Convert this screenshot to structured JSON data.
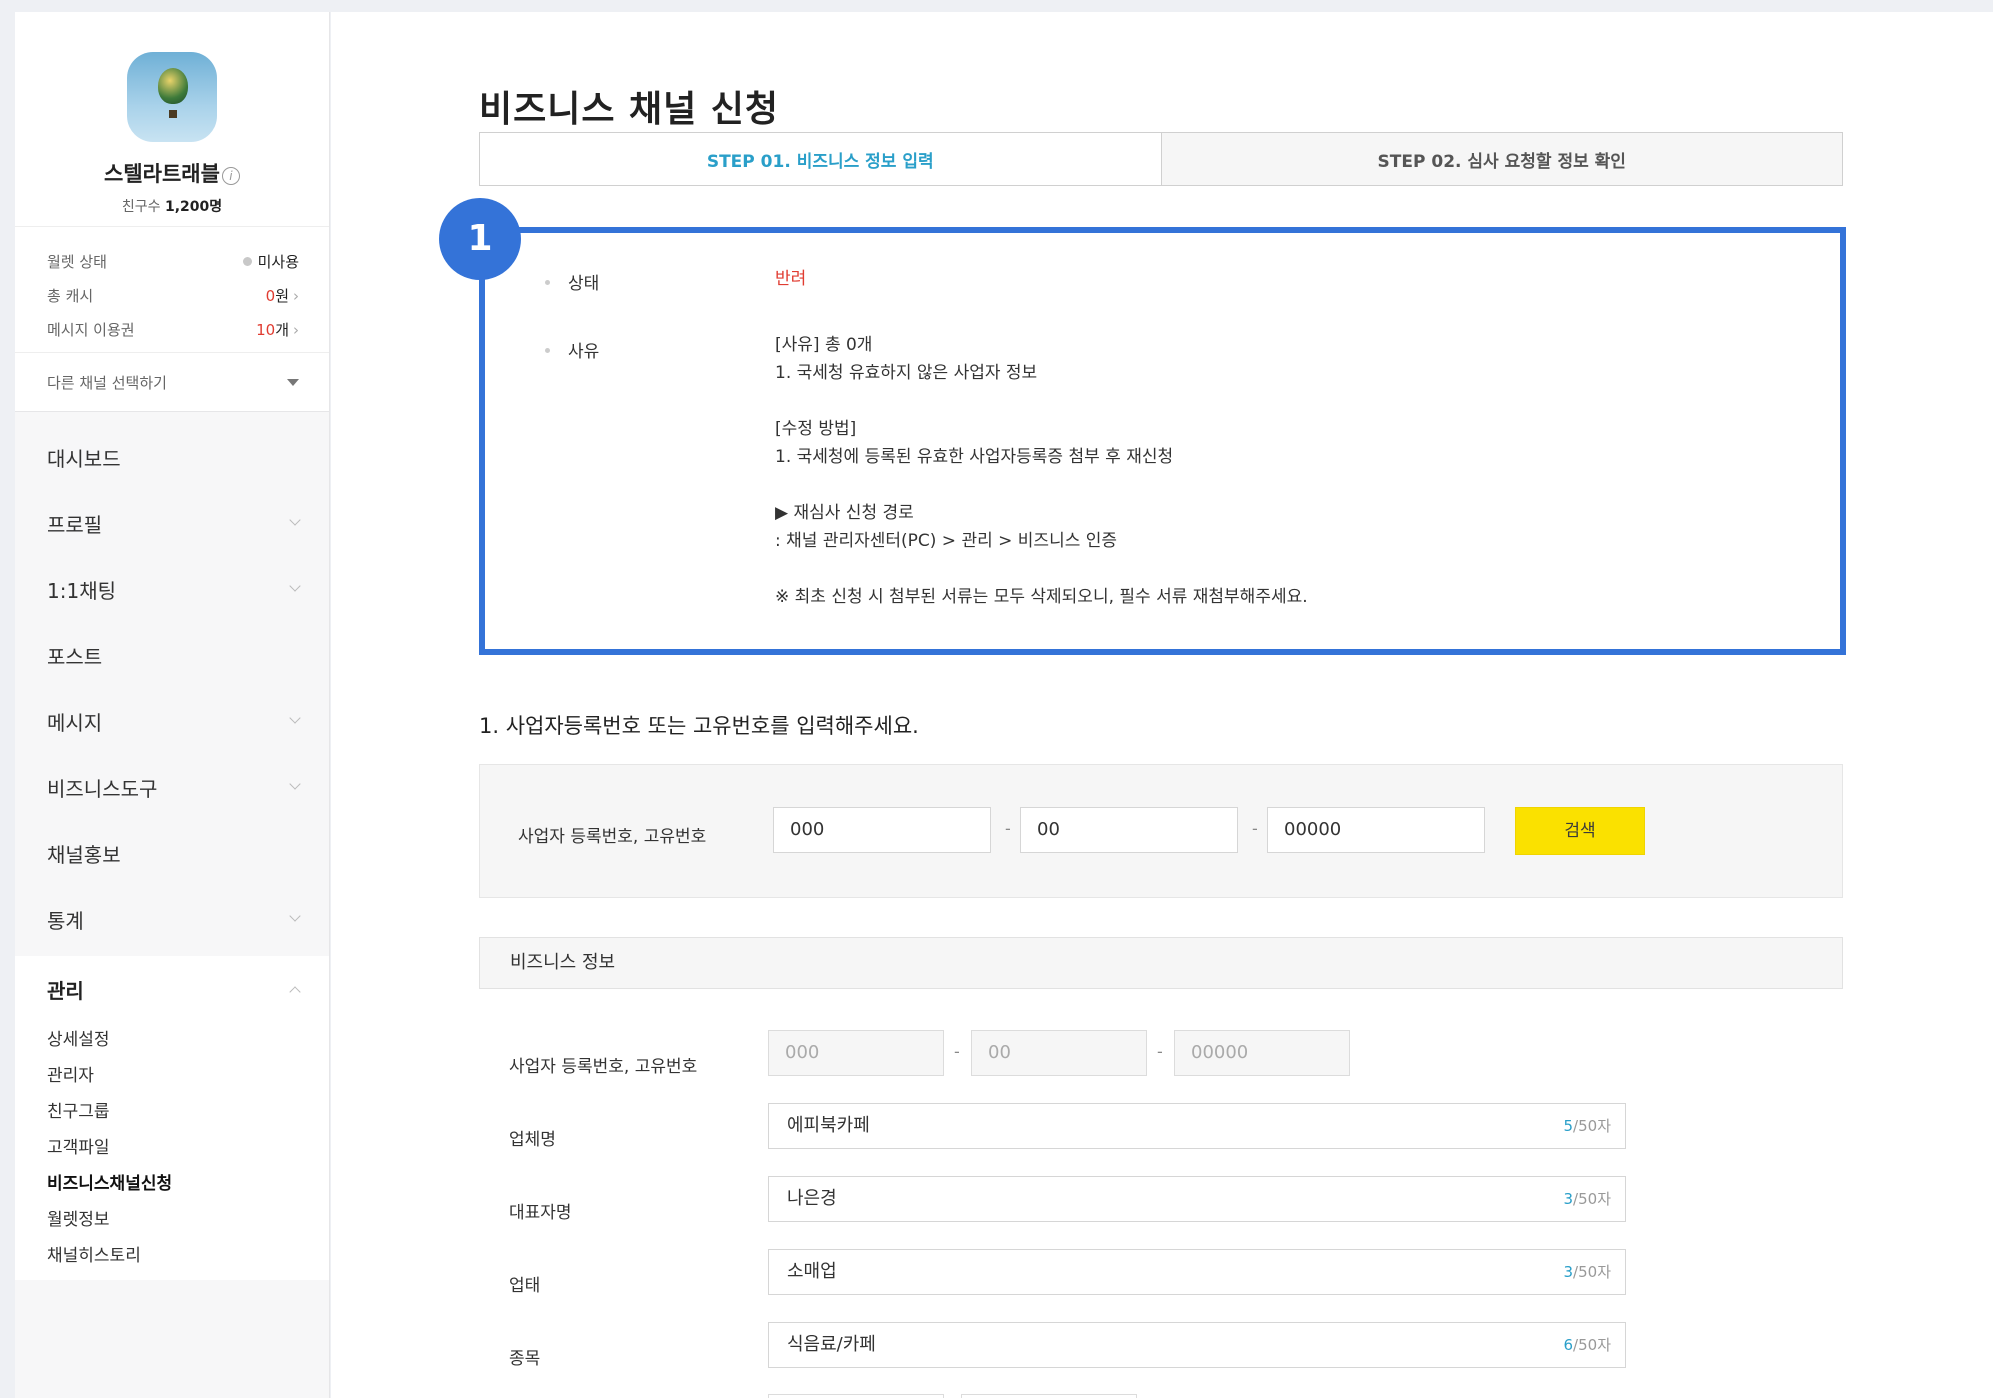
{
  "sidebar": {
    "profile_name": "스텔라트래블",
    "friends_label": "친구수",
    "friends_count": "1,200명",
    "wallet": [
      {
        "label": "월렛 상태",
        "value": "미사용",
        "highlight": ""
      },
      {
        "label": "총 캐시",
        "value": "원",
        "highlight": "0"
      },
      {
        "label": "메시지 이용권",
        "value": "개",
        "highlight": "10"
      }
    ],
    "channel_select": "다른 채널 선택하기",
    "nav": [
      {
        "label": "대시보드",
        "has_caret": false
      },
      {
        "label": "프로필",
        "has_caret": true
      },
      {
        "label": "1:1채팅",
        "has_caret": true
      },
      {
        "label": "포스트",
        "has_caret": false
      },
      {
        "label": "메시지",
        "has_caret": true
      },
      {
        "label": "비즈니스도구",
        "has_caret": true
      },
      {
        "label": "채널홍보",
        "has_caret": false
      },
      {
        "label": "통계",
        "has_caret": true
      }
    ],
    "manage_group": {
      "label": "관리",
      "items": [
        "상세설정",
        "관리자",
        "친구그룹",
        "고객파일",
        "비즈니스채널신청",
        "월렛정보",
        "채널히스토리"
      ],
      "active_index": 4
    }
  },
  "main": {
    "title": "비즈니스 채널 신청",
    "steps": [
      "STEP 01. 비즈니스 정보 입력",
      "STEP 02. 심사 요청할 정보 확인"
    ],
    "badge": "1",
    "status": {
      "status_label": "상태",
      "status_value": "반려",
      "reason_label": "사유",
      "reason_lines": [
        "[사유] 총 0개",
        "1. 국세청 유효하지 않은 사업자 정보",
        "[수정 방법]",
        "1. 국세청에 등록된 유효한 사업자등록증 첨부 후 재신청",
        "▶ 재심사 신청 경로",
        ": 채널 관리자센터(PC) > 관리 > 비즈니스 인증",
        "※ 최초 신청 시 첨부된 서류는 모두 삭제되오니, 필수 서류 재첨부해주세요."
      ]
    },
    "question": "1. 사업자등록번호 또는 고유번호를 입력해주세요.",
    "search": {
      "label": "사업자 등록번호, 고유번호",
      "part1": "000",
      "part2": "00",
      "part3": "00000",
      "separator": "-",
      "button": "검색"
    },
    "biz_info": {
      "heading": "비즈니스 정보",
      "reg_label": "사업자 등록번호, 고유번호",
      "reg_part1": "000",
      "reg_part2": "00",
      "reg_part3": "00000",
      "fields": [
        {
          "label": "업체명",
          "value": "에피북카페",
          "count": "5",
          "max": "/50자"
        },
        {
          "label": "대표자명",
          "value": "나은경",
          "count": "3",
          "max": "/50자"
        },
        {
          "label": "업태",
          "value": "소매업",
          "count": "3",
          "max": "/50자"
        },
        {
          "label": "종목",
          "value": "식음료/카페",
          "count": "6",
          "max": "/50자"
        }
      ]
    }
  }
}
